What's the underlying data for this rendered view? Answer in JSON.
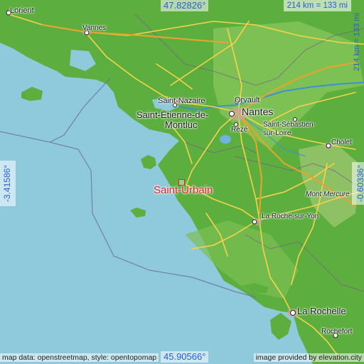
{
  "map": {
    "main_place": "Saint-Urbain",
    "coords": {
      "top": "47.82826°",
      "bottom": "45.90566°",
      "left": "-3.41586°",
      "right": "-0.60336°"
    },
    "scale": {
      "horizontal": "214 km = 133 mi",
      "vertical": "214 km = 133 mi"
    },
    "attribution": "map data: openstreetmap, style: opentopomap",
    "credit": "image provided by elevation.city",
    "places": {
      "lorient": "Lorient",
      "vannes": "Vannes",
      "saint_nazaire": "Saint-Nazaire",
      "orvault": "Orvault",
      "nantes": "Nantes",
      "saint_etienne": "Saint-Étienne-de-",
      "montluc": "Montluc",
      "reze": "Rezé",
      "saint_sebastien": "Saint-Sébastien-",
      "sur_loire": "sur-Loire",
      "cholet": "Cholet",
      "mont_mercure": "Mont Mercure",
      "la_roche": "La Roche-sur-Yon",
      "la_rochelle": "La Rochelle",
      "rochefort": "Rochefort"
    }
  },
  "colors": {
    "sea": "#8fc9dc",
    "land": "#5cae3e",
    "land_light": "#8fcb62",
    "roads": "#f6d34a",
    "highway": "#e3a52e",
    "borders": "#7a5a8a",
    "text_accent": "#2a5fd6",
    "marker": "#d8242a"
  }
}
